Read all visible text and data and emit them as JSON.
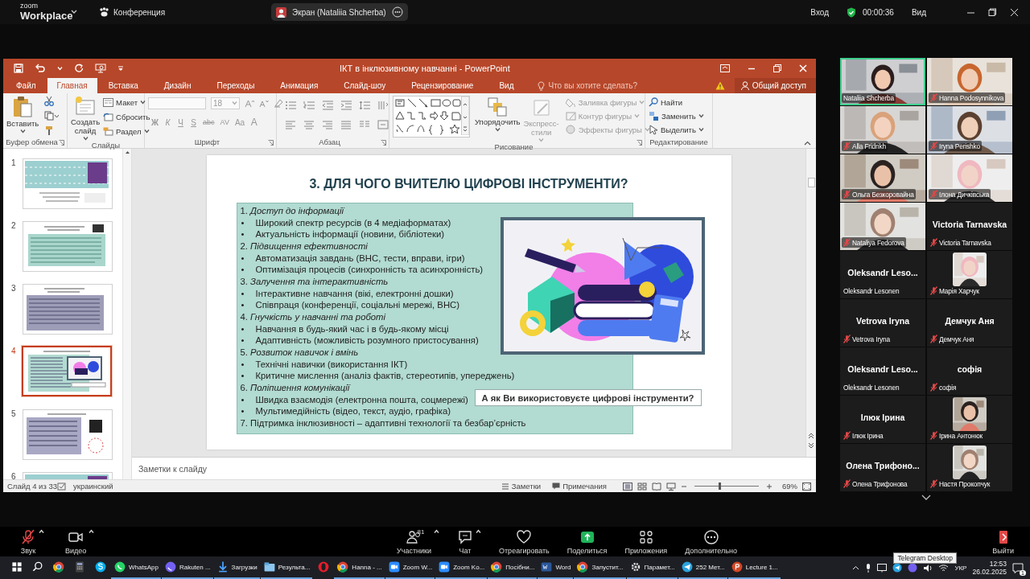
{
  "zoom_header": {
    "logo": "zoom",
    "product": "Workplace",
    "meeting": "Конференция",
    "share_label": "Экран (Nataliia Shcherba)",
    "sign_in": "Вход",
    "timer": "00:00:36",
    "view": "Вид"
  },
  "powerpoint": {
    "title": "ІКТ в інклюзивному навчанні - PowerPoint",
    "tabs": [
      {
        "label": "Файл",
        "selected": false
      },
      {
        "label": "Главная",
        "selected": true
      },
      {
        "label": "Вставка",
        "selected": false
      },
      {
        "label": "Дизайн",
        "selected": false
      },
      {
        "label": "Переходы",
        "selected": false
      },
      {
        "label": "Анимация",
        "selected": false
      },
      {
        "label": "Слайд-шоу",
        "selected": false
      },
      {
        "label": "Рецензирование",
        "selected": false
      },
      {
        "label": "Вид",
        "selected": false
      }
    ],
    "tell_me": "Что вы хотите сделать?",
    "share": "Общий доступ",
    "ribbon": {
      "clipboard": {
        "group": "Буфер обмена",
        "paste": "Вставить"
      },
      "slides": {
        "group": "Слайды",
        "new_slide": "Создать слайд",
        "layout": "Макет",
        "reset": "Сбросить",
        "section": "Раздел"
      },
      "font": {
        "group": "Шрифт",
        "size": "18",
        "buttons": [
          {
            "kind": "bold",
            "label": "Ж"
          },
          {
            "kind": "italic",
            "label": "К"
          },
          {
            "kind": "underline",
            "label": "Ч"
          },
          {
            "kind": "shadow",
            "label": "S"
          },
          {
            "kind": "strike",
            "label": "abc"
          },
          {
            "kind": "spacing",
            "label": "AV"
          },
          {
            "kind": "case",
            "label": "Aa"
          },
          {
            "kind": "color",
            "label": "A"
          }
        ]
      },
      "paragraph": {
        "group": "Абзац"
      },
      "drawing": {
        "group": "Рисование",
        "arrange": {
          "label": "Упорядочить",
          "disabled": false
        },
        "quick_styles": {
          "label": "Экспресс-стили",
          "disabled": true
        },
        "format": [
          {
            "kind": "fill",
            "label": "Заливка фигуры",
            "disabled": true
          },
          {
            "kind": "outline",
            "label": "Контур фигуры",
            "disabled": true
          },
          {
            "kind": "effects",
            "label": "Эффекты фигуры",
            "disabled": true
          }
        ]
      },
      "editing": {
        "group": "Редактирование",
        "find": "Найти",
        "replace": "Заменить",
        "select": "Выделить"
      }
    },
    "thumbnails": [
      {
        "number": "1",
        "selected": false
      },
      {
        "number": "2",
        "selected": false
      },
      {
        "number": "3",
        "selected": false
      },
      {
        "number": "4",
        "selected": true
      },
      {
        "number": "5",
        "selected": false
      },
      {
        "number": "6",
        "selected": false
      }
    ],
    "slide": {
      "title": "3. ДЛЯ ЧОГО ВЧИТЕЛЮ ЦИФРОВІ ІНСТРУМЕНТИ?",
      "lines": [
        {
          "kind": "heading",
          "text": "1. *Доступ до інформації*"
        },
        {
          "kind": "bullet",
          "marker": "•",
          "text": "Широкий спектр ресурсів (в 4 медіаформатах)"
        },
        {
          "kind": "bullet",
          "marker": "•",
          "text": "Актуальність інформації (новини, бібліотеки)"
        },
        {
          "kind": "heading",
          "text": "2. *Підвищення ефективності*"
        },
        {
          "kind": "bullet",
          "marker": "•",
          "text": "Автоматизація завдань (ВНС, тести, вправи, ігри)"
        },
        {
          "kind": "bullet",
          "marker": "•",
          "text": "Оптимізація процесів (синхронність та асинхронність)"
        },
        {
          "kind": "heading",
          "text": "3. *Залучення та інтерактивність*"
        },
        {
          "kind": "bullet",
          "marker": "•",
          "text": "Інтерактивне навчання (вікі, електронні дошки)"
        },
        {
          "kind": "bullet",
          "marker": "•",
          "text": "Співпраця (конференції, соціальні мережі, ВНС)"
        },
        {
          "kind": "heading",
          "text": "4. *Гнучкість у навчанні та роботі*"
        },
        {
          "kind": "bullet",
          "marker": "•",
          "text": "Навчання в будь-який час і в будь-якому місці"
        },
        {
          "kind": "bullet",
          "marker": "•",
          "text": "Адаптивність (можливість розумного пристосування)"
        },
        {
          "kind": "heading",
          "text": "5. *Розвиток навичок і вмінь*"
        },
        {
          "kind": "bullet",
          "marker": "•",
          "text": "Технічні навички (використання ІКТ)"
        },
        {
          "kind": "bullet",
          "marker": "•",
          "text": "Критичне мислення (аналіз фактів, стереотипів, упереджень)"
        },
        {
          "kind": "heading",
          "text": "6. *Поліпшення комунікації*"
        },
        {
          "kind": "bullet",
          "marker": "•",
          "text": "Швидка взаємодія (електронна пошта, соцмережі)"
        },
        {
          "kind": "bullet",
          "marker": "•",
          "text": "Мультимедійність (відео, текст, аудіо, графіка)"
        },
        {
          "kind": "plain",
          "text": "7. Підтримка інклюзивності – адаптивні технології та безбар’єрність"
        }
      ],
      "callout": "А як Ви використовуєте цифрові інструменти?"
    },
    "notes_placeholder": "Заметки к слайду",
    "status": {
      "slide_info": "Слайд 4 из 33",
      "language": "украинский",
      "notes": "Заметки",
      "comments": "Примечания",
      "zoom": "69%",
      "zoom_slider": {
        "level": 0.38
      }
    }
  },
  "participants": [
    {
      "kind": "video",
      "name": "Nataliia Shcherba",
      "muted": false,
      "active": true
    },
    {
      "kind": "video",
      "name": "Hanna Podosynnikova",
      "muted": true,
      "active": false
    },
    {
      "kind": "video",
      "name": "Alla Fridrikh",
      "muted": true,
      "active": false
    },
    {
      "kind": "video",
      "name": "Iryna Perishko",
      "muted": true,
      "active": false
    },
    {
      "kind": "video",
      "name": "Ольга Безкоровайна",
      "muted": true,
      "active": false
    },
    {
      "kind": "video",
      "name": "Ілона Дичківська",
      "muted": true,
      "active": false
    },
    {
      "kind": "video",
      "name": "Nataliya Fedorova",
      "muted": true,
      "active": false
    },
    {
      "kind": "name",
      "display": "Victoria Tarnavska",
      "name": "Victoria Tarnavska",
      "muted": true,
      "active": false
    },
    {
      "kind": "name",
      "display": "Oleksandr Leso...",
      "name": "Oleksandr Lesonen",
      "muted": false,
      "active": false
    },
    {
      "kind": "avatar",
      "name": "Марія Харчук",
      "muted": true,
      "active": false
    },
    {
      "kind": "name",
      "display": "Vetrova Iryna",
      "name": "Vetrova Iryna",
      "muted": true,
      "active": false
    },
    {
      "kind": "name",
      "display": "Демчук Аня",
      "name": "Демчук Аня",
      "muted": true,
      "active": false
    },
    {
      "kind": "name",
      "display": "Oleksandr Leso...",
      "name": "Oleksandr Lesonen",
      "muted": false,
      "active": false
    },
    {
      "kind": "name",
      "display": "софія",
      "name": "софія",
      "muted": true,
      "active": false
    },
    {
      "kind": "name",
      "display": "Ілюк Ірина",
      "name": "Ілюк Ірина",
      "muted": true,
      "active": false
    },
    {
      "kind": "avatar",
      "name": "Ірина Антонюк",
      "muted": true,
      "active": false
    },
    {
      "kind": "name",
      "display": "Олена Трифоно...",
      "name": "Олена Трифонова",
      "muted": true,
      "active": false
    },
    {
      "kind": "avatar",
      "name": "Настя Прокопчук",
      "muted": true,
      "active": false
    }
  ],
  "meeting_controls": [
    {
      "kind": "mic",
      "label": "Звук",
      "muted": true,
      "menu": true
    },
    {
      "kind": "video",
      "label": "Видео",
      "menu": true
    },
    {
      "kind": "participants",
      "label": "Участники",
      "count": "81",
      "menu": true
    },
    {
      "kind": "chat",
      "label": "Чат",
      "menu": true
    },
    {
      "kind": "react",
      "label": "Отреагировать",
      "menu": false
    },
    {
      "kind": "share",
      "label": "Поделиться",
      "menu": false
    },
    {
      "kind": "apps",
      "label": "Приложения",
      "menu": false
    },
    {
      "kind": "more",
      "label": "Дополнительно",
      "menu": false
    },
    {
      "kind": "leave",
      "label": "Выйти",
      "menu": false
    }
  ],
  "taskbar": {
    "apps": [
      {
        "kind": "start"
      },
      {
        "kind": "search"
      },
      {
        "kind": "browser"
      },
      {
        "kind": "calculator"
      },
      {
        "kind": "skype"
      },
      {
        "kind": "whatsapp",
        "label": "WhatsApp"
      },
      {
        "kind": "viber",
        "label": "Rakuten ..."
      },
      {
        "kind": "downloads",
        "label": "Загрузки"
      },
      {
        "kind": "folder",
        "label": "Результа..."
      },
      {
        "kind": "opera"
      },
      {
        "kind": "browser",
        "label": "Hanna - ..."
      },
      {
        "kind": "zoom",
        "label": "Zoom W..."
      },
      {
        "kind": "zoom",
        "label": "Zoom Ko..."
      },
      {
        "kind": "browser",
        "label": "Посібни..."
      },
      {
        "kind": "word",
        "label": "Word"
      },
      {
        "kind": "browser",
        "label": "Запустит..."
      },
      {
        "kind": "settings",
        "label": "Парамет..."
      },
      {
        "kind": "telegram",
        "label": "252 Мет..."
      },
      {
        "kind": "powerpoint",
        "label": "Lecture 1..."
      }
    ],
    "tooltip": "Telegram Desktop",
    "language": "УКР",
    "time": "12:53",
    "date": "26.02.2025",
    "notifications": "1"
  }
}
